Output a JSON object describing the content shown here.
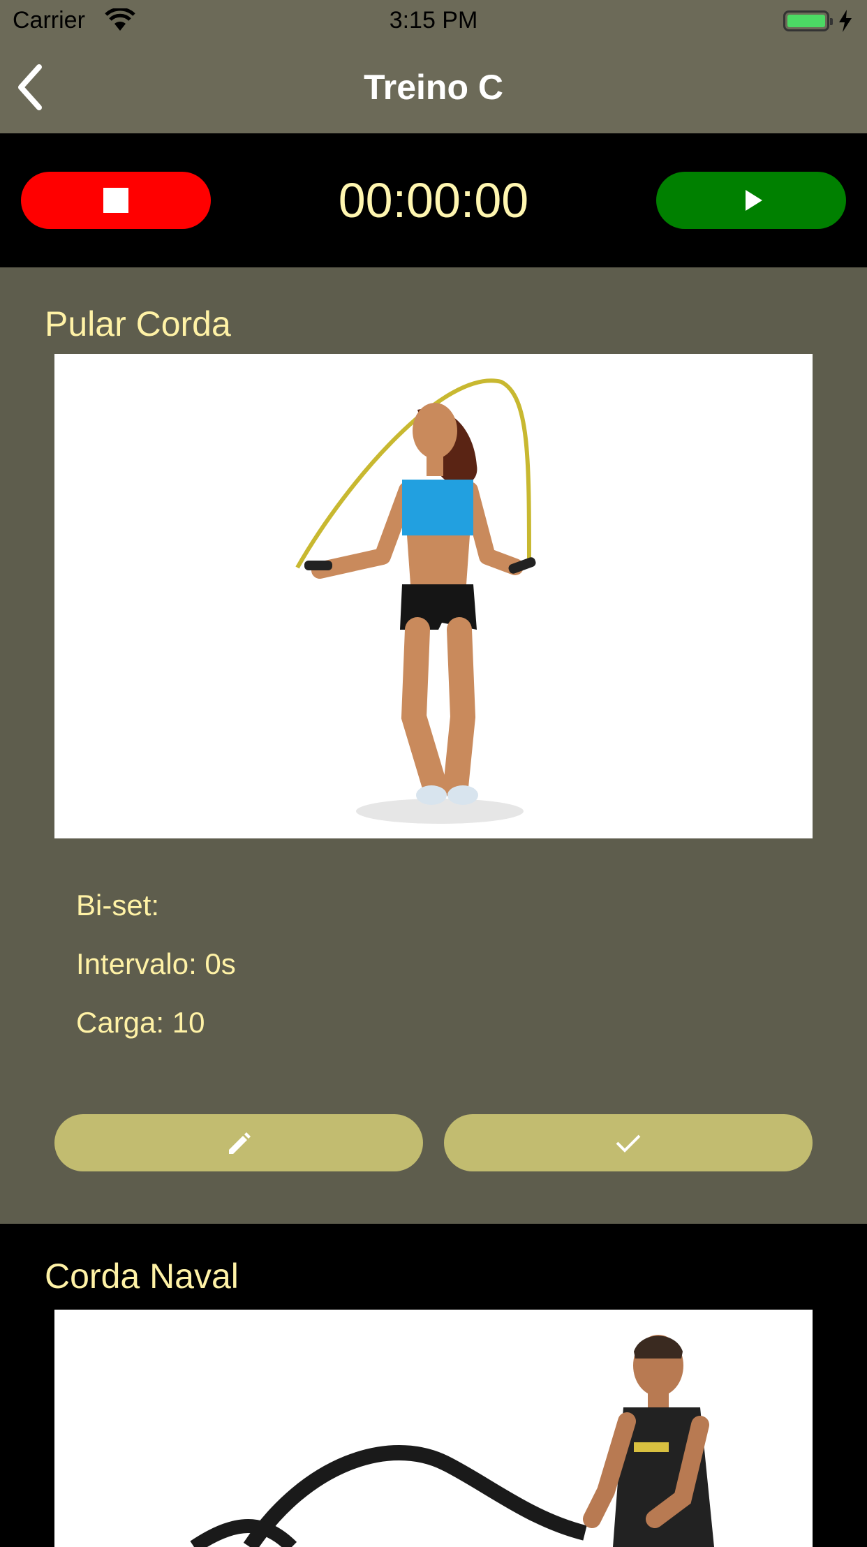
{
  "status_bar": {
    "carrier": "Carrier",
    "time": "3:15 PM",
    "icons": [
      "wifi-icon",
      "battery-icon",
      "charging-bolt-icon"
    ]
  },
  "nav": {
    "title": "Treino C",
    "back_icon": "chevron-left-icon"
  },
  "timer": {
    "value": "00:00:00",
    "stop_icon": "stop-icon",
    "play_icon": "play-icon"
  },
  "exercises": [
    {
      "name": "Pular Corda",
      "image": "jump-rope-photo",
      "details": [
        "Bi-set:",
        "Intervalo: 0s",
        "Carga: 10"
      ],
      "edit_icon": "pencil-icon",
      "done_icon": "check-icon"
    },
    {
      "name": "Corda Naval",
      "image": "battle-rope-photo"
    }
  ],
  "colors": {
    "header_bg": "#6c6a58",
    "card_bg": "#5e5d4d",
    "text_accent": "#fff2a6",
    "stop_red": "#ff0000",
    "play_green": "#008000",
    "action_button": "#c2bc70"
  }
}
